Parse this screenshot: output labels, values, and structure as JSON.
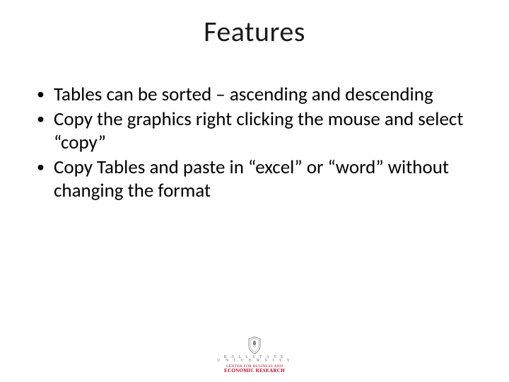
{
  "title": "Features",
  "bullets": [
    "Tables can be sorted – ascending and descending",
    "Copy the graphics right clicking the mouse and select “copy”",
    "Copy Tables and paste in “excel” or “word” without changing the format"
  ],
  "footer": {
    "line1": "B A L L  S T A T E",
    "line2": "U N I V E R S I T Y",
    "line3": "CENTER FOR BUSINESS AND",
    "line4": "ECONOMIC RESEARCH"
  }
}
